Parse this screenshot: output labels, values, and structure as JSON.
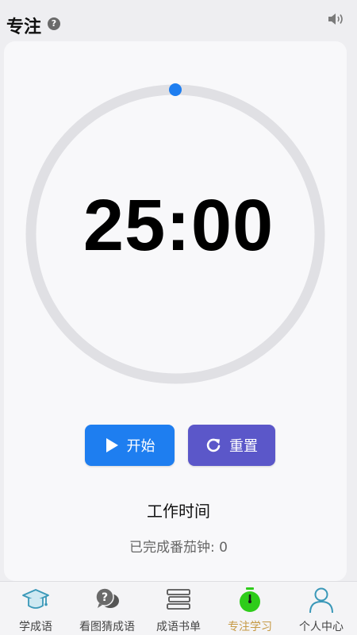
{
  "header": {
    "title": "专注",
    "help_icon": "?"
  },
  "timer": {
    "time": "25:00",
    "progress": 0,
    "ring_color": "#e0e0e4",
    "knob_color": "#1e7ef0"
  },
  "controls": {
    "start_label": "开始",
    "reset_label": "重置",
    "start_color": "#1e7ef0",
    "reset_color": "#5b57c9"
  },
  "status": {
    "mode": "工作时间",
    "completed": "已完成番茄钟: 0"
  },
  "tabbar": {
    "active_color": "#c69a45",
    "items": [
      {
        "label": "学成语",
        "icon": "graduation-cap-icon"
      },
      {
        "label": "看图猜成语",
        "icon": "question-bubble-icon"
      },
      {
        "label": "成语书单",
        "icon": "book-stack-icon"
      },
      {
        "label": "专注学习",
        "icon": "stopwatch-icon",
        "active": true
      },
      {
        "label": "个人中心",
        "icon": "person-icon"
      }
    ]
  }
}
